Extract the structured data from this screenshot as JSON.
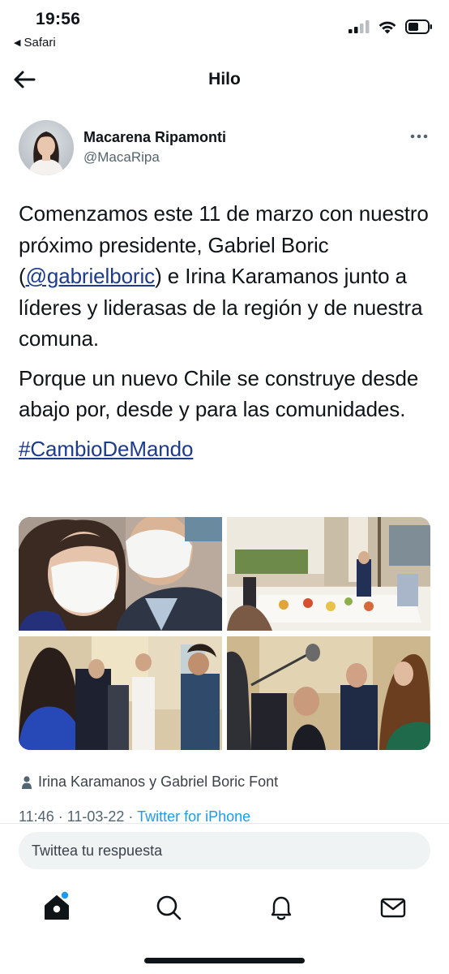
{
  "status_bar": {
    "time": "19:56",
    "back_app": "Safari"
  },
  "header": {
    "title": "Hilo"
  },
  "tweet": {
    "author_name": "Macarena Ripamonti",
    "author_handle": "@MacaRipa",
    "paragraph1_pre": "Comenzamos este 11 de marzo con nuestro próximo presidente, Gabriel Boric (",
    "mention": "@gabrielboric",
    "paragraph1_post": ") e Irina Karamanos junto a líderes y liderasas de la región y de nuestra comuna.",
    "paragraph2": "Porque un nuevo Chile se construye desde abajo por, desde y para las comunidades.",
    "hashtag": "#CambioDeMando",
    "tagged_people": "Irina Karamanos y Gabriel Boric Font",
    "meta_time_date": "11:46 · 11-03-22 · ",
    "meta_source": "Twitter for iPhone"
  },
  "reply": {
    "placeholder": "Twittea tu respuesta"
  },
  "tabbar": {
    "icons": [
      "home-icon",
      "search-icon",
      "notifications-icon",
      "messages-icon"
    ],
    "home_notification_dot": true
  },
  "colors": {
    "link": "#1d3b8c",
    "accent": "#1d9bf0",
    "text": "#0f1419",
    "secondary": "#536471"
  }
}
